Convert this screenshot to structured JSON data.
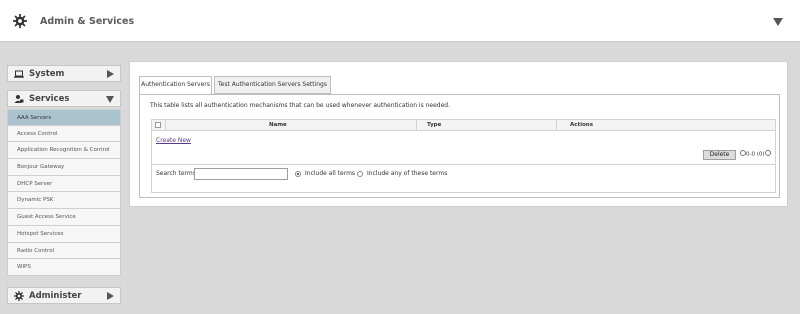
{
  "header": {
    "title": "Admin & Services",
    "icon": "gear-icon",
    "collapse_icon": "triangle-down-icon"
  },
  "sidebar": {
    "sections": {
      "system": {
        "label": "System",
        "icon": "laptop-icon"
      },
      "services": {
        "label": "Services",
        "icon": "users-icon"
      },
      "administer": {
        "label": "Administer",
        "icon": "gear-icon"
      }
    },
    "items": [
      {
        "label": "AAA Servers",
        "active": true
      },
      {
        "label": "Access Control"
      },
      {
        "label": "Application Recognition & Control"
      },
      {
        "label": "Bonjour Gateway"
      },
      {
        "label": "DHCP Server"
      },
      {
        "label": "Dynamic PSK"
      },
      {
        "label": "Guest Access Service"
      },
      {
        "label": "Hotspot Services"
      },
      {
        "label": "Radio Control"
      },
      {
        "label": "WIPS"
      }
    ]
  },
  "main": {
    "tabs": [
      {
        "label": "Authentication Servers",
        "active": true
      },
      {
        "label": "Test Authentication Servers Settings"
      }
    ],
    "description": "This table lists all authentication mechanisms that can be used whenever authentication is needed.",
    "table": {
      "columns": [
        "Name",
        "Type",
        "Actions"
      ],
      "create_link": "Create New",
      "delete_label": "Delete",
      "pager_text": "0-0 (0)"
    },
    "search": {
      "label": "Search terms",
      "value": "",
      "options": [
        "Include all terms",
        "Include any of these terms"
      ],
      "selected": "Include all terms"
    }
  }
}
